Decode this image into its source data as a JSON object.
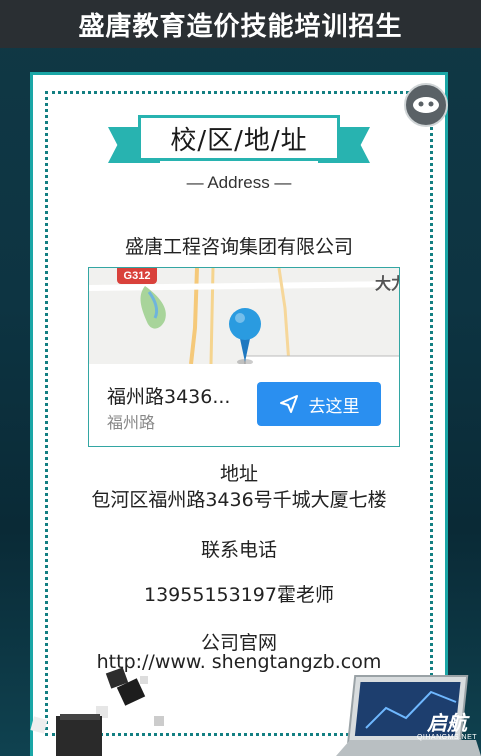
{
  "header": {
    "title": "盛唐教育造价技能培训招生"
  },
  "section": {
    "title": "校/区/地/址",
    "subtitle": "— Address —"
  },
  "company": {
    "name": "盛唐工程咨询集团有限公司"
  },
  "map": {
    "road_badge": "G312",
    "corner_label": "大力",
    "location_name": "福州路3436...",
    "location_sub": "福州路",
    "go_button_label": "去这里",
    "pin_color": "#2a9be0",
    "button_color": "#2a8ff0"
  },
  "address": {
    "label": "地址",
    "value": "包河区福州路3436号千城大厦七楼"
  },
  "phone": {
    "label": "联系电话",
    "value": "13955153197霍老师"
  },
  "website": {
    "label": "公司官网",
    "value": "http://www. shengtangzb.com"
  },
  "watermark": {
    "brand": "启航",
    "sub": "QIHANGMS.NET"
  },
  "colors": {
    "teal": "#28b3b0",
    "dark_teal": "#137f82",
    "header_bg": "#2a2f33"
  }
}
